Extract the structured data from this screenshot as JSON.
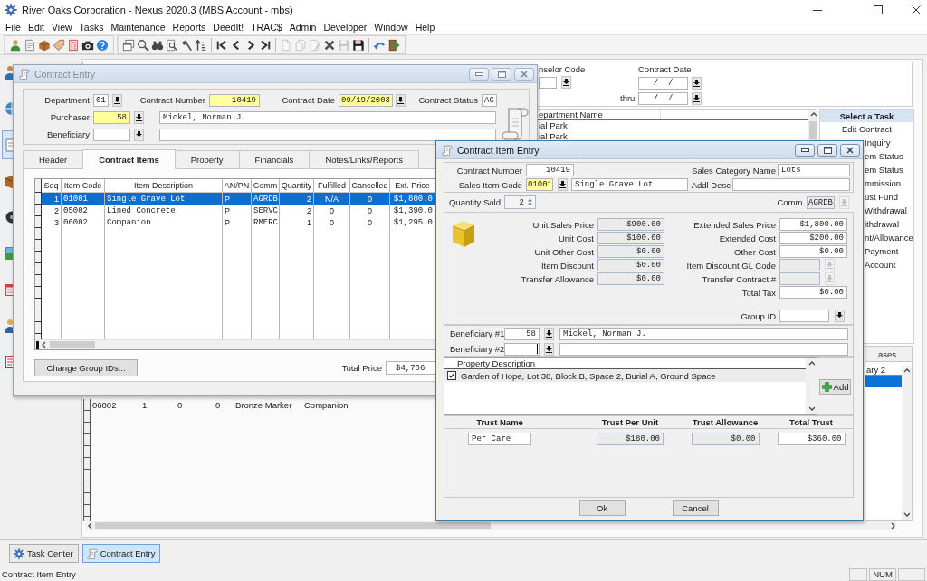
{
  "app": {
    "title": "River Oaks Corporation - Nexus 2020.3 (MBS Account - mbs)"
  },
  "menu": [
    "File",
    "Edit",
    "View",
    "Tasks",
    "Maintenance",
    "Reports",
    "DeedIt!",
    "TRAC$",
    "Admin",
    "Developer",
    "Window",
    "Help"
  ],
  "toolbar": {
    "bands": [
      {
        "groups": [
          [
            {
              "disabled": false
            },
            {
              "disabled": false
            },
            {
              "disabled": false
            },
            {
              "disabled": false
            },
            {
              "disabled": false
            },
            {
              "disabled": false
            },
            {
              "disabled": false
            }
          ]
        ]
      },
      {
        "groups": [
          [
            {
              "disabled": false
            },
            {
              "disabled": false
            },
            {
              "disabled": false
            },
            {
              "disabled": false
            },
            {
              "disabled": false
            },
            {
              "disabled": false
            }
          ],
          [
            {
              "disabled": false
            },
            {
              "disabled": false
            },
            {
              "disabled": false
            },
            {
              "disabled": false
            }
          ],
          [
            {
              "disabled": true
            },
            {
              "disabled": true
            },
            {
              "disabled": true
            },
            {
              "disabled": false
            },
            {
              "disabled": true
            },
            {
              "disabled": false
            }
          ],
          [
            {
              "disabled": false
            },
            {
              "disabled": false
            }
          ]
        ]
      }
    ]
  },
  "task_center": {
    "sidebar": [
      {
        "selected": false
      },
      {
        "selected": false
      },
      {
        "selected": true
      },
      {
        "selected": false
      },
      {
        "selected": false
      },
      {
        "selected": false
      },
      {
        "selected": false
      },
      {
        "selected": false
      },
      {
        "selected": false
      }
    ],
    "counselor_code": {
      "label": "nselor Code"
    },
    "contract_date": {
      "label": "Contract Date",
      "from": "/  /",
      "thru_label": "thru",
      "to": "/  /"
    },
    "department_list": {
      "header": "epartment Name",
      "rows": [
        "ial Park",
        "ial Park"
      ]
    },
    "task_panel": {
      "title": "Select a Task",
      "items": [
        "Edit Contract",
        "Inquiry",
        "em Status",
        "em Status",
        "mmission",
        "ust Fund",
        "Withdrawal",
        "ithdrawal",
        "nt/Allowance",
        "Payment",
        "Account"
      ]
    },
    "items_grid": {
      "rows": [
        [
          "06002",
          "1",
          "0",
          "0",
          "Bronze Marker",
          "Companion"
        ]
      ]
    },
    "side_tab": {
      "label": "ases"
    },
    "side_list": {
      "header": "ary 2",
      "rows": [
        {
          "selected": true
        }
      ]
    }
  },
  "contract_entry": {
    "title": "Contract Entry",
    "active": false,
    "department": {
      "label": "Department",
      "value": "01",
      "highlighted": false
    },
    "contract_number": {
      "label": "Contract Number",
      "value": "10419",
      "highlighted": true
    },
    "contract_date": {
      "label": "Contract Date",
      "value": "09/19/2003",
      "highlighted": true
    },
    "contract_status": {
      "label": "Contract Status",
      "value": "AC",
      "highlighted": false
    },
    "purchaser": {
      "label": "Purchaser",
      "number": "58",
      "name": "Mickel, Norman J.",
      "highlighted": true
    },
    "beneficiary": {
      "label": "Beneficiary",
      "highlighted": false
    },
    "tabs": [
      {
        "label": "Header",
        "selected": false
      },
      {
        "label": "Contract Items",
        "selected": true
      },
      {
        "label": "Property",
        "selected": false
      },
      {
        "label": "Financials",
        "selected": false
      },
      {
        "label": "Notes/Links/Reports",
        "selected": false
      }
    ],
    "items_table": {
      "columns": [
        "Seq",
        "Item Code",
        "Item Description",
        "AN/PN",
        "Comm",
        "Quantity",
        "Fulfilled",
        "Cancelled",
        "Ext. Price"
      ],
      "rows": [
        {
          "selected": true,
          "cells": [
            "1",
            "01001",
            "Single Grave Lot",
            "P",
            "AGRDB",
            "2",
            "N/A",
            "0",
            "$1,800.0"
          ]
        },
        {
          "selected": false,
          "cells": [
            "2",
            "05002",
            "Lined Concrete",
            "P",
            "SERVC",
            "2",
            "0",
            "0",
            "$1,390.0"
          ]
        },
        {
          "selected": false,
          "cells": [
            "3",
            "06002",
            "Companion",
            "P",
            "RMERC",
            "1",
            "0",
            "0",
            "$1,295.0"
          ]
        }
      ]
    },
    "change_group_button": {
      "label": "Change Group IDs..."
    },
    "total_price": {
      "label": "Total Price",
      "value": "$4,706"
    }
  },
  "item_entry": {
    "title": "Contract Item Entry",
    "active": true,
    "contract_number": {
      "label": "Contract Number",
      "value": "10419",
      "highlighted": false
    },
    "sales_item_code": {
      "label": "Sales Item Code",
      "value": "01001",
      "description": "Single Grave Lot",
      "highlighted": true
    },
    "sales_category_name": {
      "label": "Sales Category Name",
      "value": "Lots"
    },
    "addl_desc": {
      "label": "Addl Desc"
    },
    "quantity_sold": {
      "label": "Quantity Sold",
      "value": "2"
    },
    "comm": {
      "label": "Comm.",
      "value": "AGRDB",
      "read_only": true,
      "lookup_disabled": true
    },
    "pricing_left": [
      {
        "label": "Unit Sales Price",
        "value": "$900.00",
        "read_only": true
      },
      {
        "label": "Unit Cost",
        "value": "$100.00",
        "read_only": true
      },
      {
        "label": "Unit Other Cost",
        "value": "$0.00",
        "read_only": true
      },
      {
        "label": "Item Discount",
        "value": "$0.00",
        "read_only": true
      },
      {
        "label": "Transfer Allowance",
        "value": "$0.00",
        "read_only": true
      }
    ],
    "pricing_right": [
      {
        "kind": "amount",
        "label": "Extended Sales Price",
        "value": "$1,800.00"
      },
      {
        "kind": "amount",
        "label": "Extended Cost",
        "value": "$200.00"
      },
      {
        "kind": "amount",
        "label": "Other Cost",
        "value": "$0.00"
      },
      {
        "kind": "lookup",
        "label": "Item Discount GL Code",
        "disabled": true
      },
      {
        "kind": "lookup",
        "label": "Transfer Contract #",
        "disabled": true
      },
      {
        "kind": "amount",
        "label": "Total Tax",
        "value": "$0.00"
      }
    ],
    "group_id": {
      "label": "Group ID"
    },
    "beneficiaries": [
      {
        "label": "Beneficiary #1",
        "number": "58",
        "name": "Mickel, Norman J.",
        "focused": false
      },
      {
        "label": "Beneficiary #2",
        "focused": true
      }
    ],
    "property_list": {
      "header": "Property Description",
      "rows": [
        {
          "text": "Garden of Hope, Lot 38, Block B, Space 2, Burial A, Ground Space",
          "checked": true,
          "selected": true
        }
      ]
    },
    "add_button": {
      "label": "Add"
    },
    "trust": {
      "columns": [
        "Trust Name",
        "Trust Per Unit",
        "Trust Allowance",
        "Total Trust"
      ],
      "rows": [
        {
          "cells": [
            {
              "value": "Per Care",
              "read_only": false
            },
            {
              "value": "$180.00",
              "read_only": true
            },
            {
              "value": "$0.00",
              "read_only": true
            },
            {
              "value": "$360.00",
              "read_only": false
            }
          ]
        }
      ]
    },
    "buttons": [
      {
        "label": "Ok"
      },
      {
        "label": "Cancel"
      }
    ]
  },
  "taskbar": [
    {
      "label": "Task Center",
      "selected": false
    },
    {
      "label": "Contract Entry",
      "selected": true
    }
  ],
  "status_bar": {
    "message": "Contract Item Entry",
    "num_lock": "NUM"
  }
}
